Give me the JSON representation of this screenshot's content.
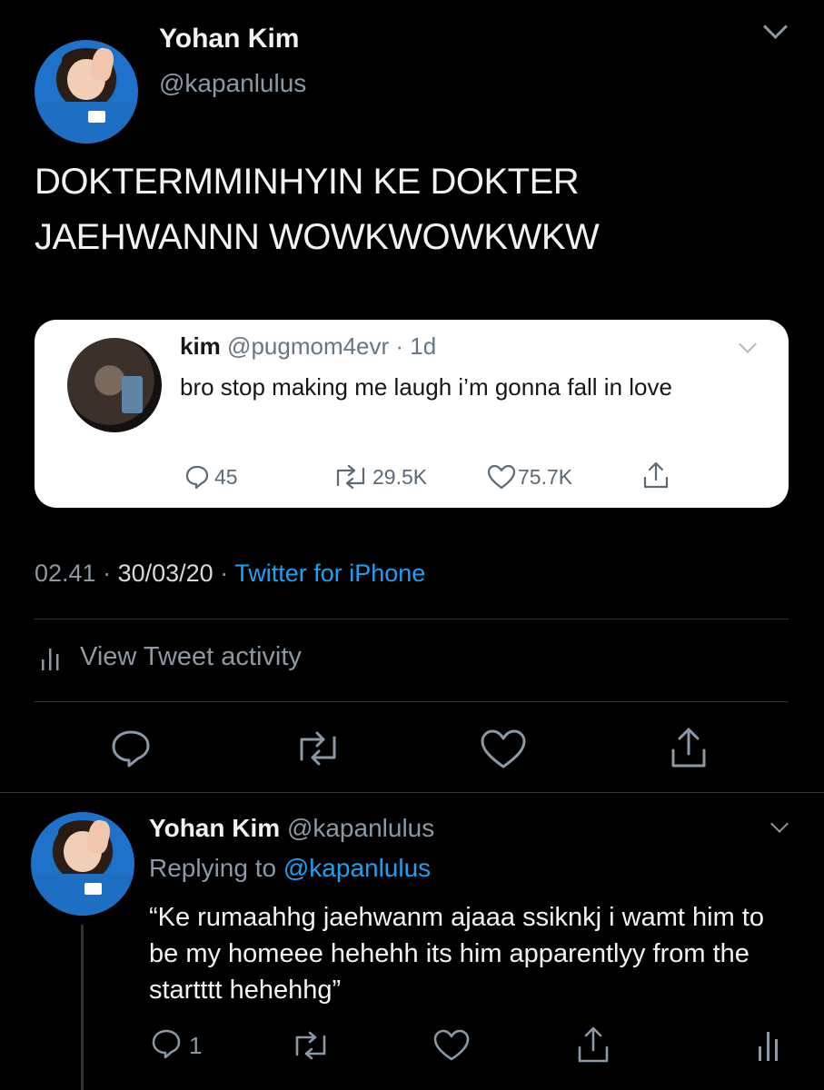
{
  "tweet": {
    "author_name": "Yohan Kim",
    "author_handle": "@kapanlulus",
    "text": "DOKTERMMINHYIN KE DOKTER JAEHWANNN WOWKWOWKWKW",
    "time": "02.41",
    "date": "30/03/20",
    "source": "Twitter for iPhone",
    "activity_label": "View Tweet activity"
  },
  "quoted": {
    "name": "kim",
    "handle": "@pugmom4evr",
    "age": "· 1d",
    "text": "bro stop making me laugh i’m gonna fall in love",
    "replies": "45",
    "retweets": "29.5K",
    "likes": "75.7K"
  },
  "reply": {
    "author_name": "Yohan Kim",
    "author_handle": "@kapanlulus",
    "replying_prefix": "Replying to",
    "replying_to": "@kapanlulus",
    "text": "“Ke rumaahhg jaehwanm ajaaa ssiknkj i wamt him to be my homeee hehehh its him apparentlyy from the startttt hehehhg”",
    "reply_count": "1"
  },
  "colors": {
    "background": "#000000",
    "accent": "#1da1f2",
    "muted": "#8b98a5"
  }
}
